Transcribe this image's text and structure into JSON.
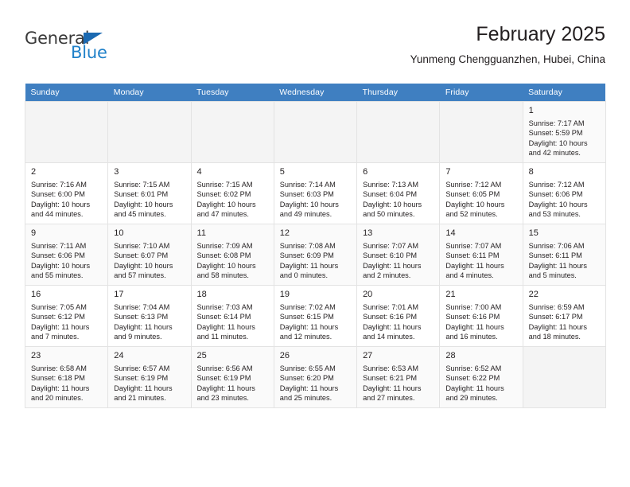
{
  "brand": {
    "name_part1": "General",
    "name_part2": "Blue",
    "accent_color": "#2081c9",
    "triangle_color": "#1b69b1"
  },
  "header": {
    "title": "February 2025",
    "subtitle": "Yunmeng Chengguanzhen, Hubei, China"
  },
  "calendar": {
    "header_bg": "#3f7fc1",
    "weekdays": [
      "Sunday",
      "Monday",
      "Tuesday",
      "Wednesday",
      "Thursday",
      "Friday",
      "Saturday"
    ],
    "labels": {
      "sunrise": "Sunrise:",
      "sunset": "Sunset:",
      "daylight": "Daylight:"
    },
    "weeks": [
      {
        "days": [
          {
            "empty": true
          },
          {
            "empty": true
          },
          {
            "empty": true
          },
          {
            "empty": true
          },
          {
            "empty": true
          },
          {
            "empty": true
          },
          {
            "day": "1",
            "sunrise": "Sunrise: 7:17 AM",
            "sunset": "Sunset: 5:59 PM",
            "daylight_line1": "Daylight: 10 hours",
            "daylight_line2": "and 42 minutes."
          }
        ]
      },
      {
        "days": [
          {
            "day": "2",
            "sunrise": "Sunrise: 7:16 AM",
            "sunset": "Sunset: 6:00 PM",
            "daylight_line1": "Daylight: 10 hours",
            "daylight_line2": "and 44 minutes."
          },
          {
            "day": "3",
            "sunrise": "Sunrise: 7:15 AM",
            "sunset": "Sunset: 6:01 PM",
            "daylight_line1": "Daylight: 10 hours",
            "daylight_line2": "and 45 minutes."
          },
          {
            "day": "4",
            "sunrise": "Sunrise: 7:15 AM",
            "sunset": "Sunset: 6:02 PM",
            "daylight_line1": "Daylight: 10 hours",
            "daylight_line2": "and 47 minutes."
          },
          {
            "day": "5",
            "sunrise": "Sunrise: 7:14 AM",
            "sunset": "Sunset: 6:03 PM",
            "daylight_line1": "Daylight: 10 hours",
            "daylight_line2": "and 49 minutes."
          },
          {
            "day": "6",
            "sunrise": "Sunrise: 7:13 AM",
            "sunset": "Sunset: 6:04 PM",
            "daylight_line1": "Daylight: 10 hours",
            "daylight_line2": "and 50 minutes."
          },
          {
            "day": "7",
            "sunrise": "Sunrise: 7:12 AM",
            "sunset": "Sunset: 6:05 PM",
            "daylight_line1": "Daylight: 10 hours",
            "daylight_line2": "and 52 minutes."
          },
          {
            "day": "8",
            "sunrise": "Sunrise: 7:12 AM",
            "sunset": "Sunset: 6:06 PM",
            "daylight_line1": "Daylight: 10 hours",
            "daylight_line2": "and 53 minutes."
          }
        ]
      },
      {
        "days": [
          {
            "day": "9",
            "sunrise": "Sunrise: 7:11 AM",
            "sunset": "Sunset: 6:06 PM",
            "daylight_line1": "Daylight: 10 hours",
            "daylight_line2": "and 55 minutes."
          },
          {
            "day": "10",
            "sunrise": "Sunrise: 7:10 AM",
            "sunset": "Sunset: 6:07 PM",
            "daylight_line1": "Daylight: 10 hours",
            "daylight_line2": "and 57 minutes."
          },
          {
            "day": "11",
            "sunrise": "Sunrise: 7:09 AM",
            "sunset": "Sunset: 6:08 PM",
            "daylight_line1": "Daylight: 10 hours",
            "daylight_line2": "and 58 minutes."
          },
          {
            "day": "12",
            "sunrise": "Sunrise: 7:08 AM",
            "sunset": "Sunset: 6:09 PM",
            "daylight_line1": "Daylight: 11 hours",
            "daylight_line2": "and 0 minutes."
          },
          {
            "day": "13",
            "sunrise": "Sunrise: 7:07 AM",
            "sunset": "Sunset: 6:10 PM",
            "daylight_line1": "Daylight: 11 hours",
            "daylight_line2": "and 2 minutes."
          },
          {
            "day": "14",
            "sunrise": "Sunrise: 7:07 AM",
            "sunset": "Sunset: 6:11 PM",
            "daylight_line1": "Daylight: 11 hours",
            "daylight_line2": "and 4 minutes."
          },
          {
            "day": "15",
            "sunrise": "Sunrise: 7:06 AM",
            "sunset": "Sunset: 6:11 PM",
            "daylight_line1": "Daylight: 11 hours",
            "daylight_line2": "and 5 minutes."
          }
        ]
      },
      {
        "days": [
          {
            "day": "16",
            "sunrise": "Sunrise: 7:05 AM",
            "sunset": "Sunset: 6:12 PM",
            "daylight_line1": "Daylight: 11 hours",
            "daylight_line2": "and 7 minutes."
          },
          {
            "day": "17",
            "sunrise": "Sunrise: 7:04 AM",
            "sunset": "Sunset: 6:13 PM",
            "daylight_line1": "Daylight: 11 hours",
            "daylight_line2": "and 9 minutes."
          },
          {
            "day": "18",
            "sunrise": "Sunrise: 7:03 AM",
            "sunset": "Sunset: 6:14 PM",
            "daylight_line1": "Daylight: 11 hours",
            "daylight_line2": "and 11 minutes."
          },
          {
            "day": "19",
            "sunrise": "Sunrise: 7:02 AM",
            "sunset": "Sunset: 6:15 PM",
            "daylight_line1": "Daylight: 11 hours",
            "daylight_line2": "and 12 minutes."
          },
          {
            "day": "20",
            "sunrise": "Sunrise: 7:01 AM",
            "sunset": "Sunset: 6:16 PM",
            "daylight_line1": "Daylight: 11 hours",
            "daylight_line2": "and 14 minutes."
          },
          {
            "day": "21",
            "sunrise": "Sunrise: 7:00 AM",
            "sunset": "Sunset: 6:16 PM",
            "daylight_line1": "Daylight: 11 hours",
            "daylight_line2": "and 16 minutes."
          },
          {
            "day": "22",
            "sunrise": "Sunrise: 6:59 AM",
            "sunset": "Sunset: 6:17 PM",
            "daylight_line1": "Daylight: 11 hours",
            "daylight_line2": "and 18 minutes."
          }
        ]
      },
      {
        "days": [
          {
            "day": "23",
            "sunrise": "Sunrise: 6:58 AM",
            "sunset": "Sunset: 6:18 PM",
            "daylight_line1": "Daylight: 11 hours",
            "daylight_line2": "and 20 minutes."
          },
          {
            "day": "24",
            "sunrise": "Sunrise: 6:57 AM",
            "sunset": "Sunset: 6:19 PM",
            "daylight_line1": "Daylight: 11 hours",
            "daylight_line2": "and 21 minutes."
          },
          {
            "day": "25",
            "sunrise": "Sunrise: 6:56 AM",
            "sunset": "Sunset: 6:19 PM",
            "daylight_line1": "Daylight: 11 hours",
            "daylight_line2": "and 23 minutes."
          },
          {
            "day": "26",
            "sunrise": "Sunrise: 6:55 AM",
            "sunset": "Sunset: 6:20 PM",
            "daylight_line1": "Daylight: 11 hours",
            "daylight_line2": "and 25 minutes."
          },
          {
            "day": "27",
            "sunrise": "Sunrise: 6:53 AM",
            "sunset": "Sunset: 6:21 PM",
            "daylight_line1": "Daylight: 11 hours",
            "daylight_line2": "and 27 minutes."
          },
          {
            "day": "28",
            "sunrise": "Sunrise: 6:52 AM",
            "sunset": "Sunset: 6:22 PM",
            "daylight_line1": "Daylight: 11 hours",
            "daylight_line2": "and 29 minutes."
          },
          {
            "empty": true
          }
        ]
      }
    ]
  }
}
